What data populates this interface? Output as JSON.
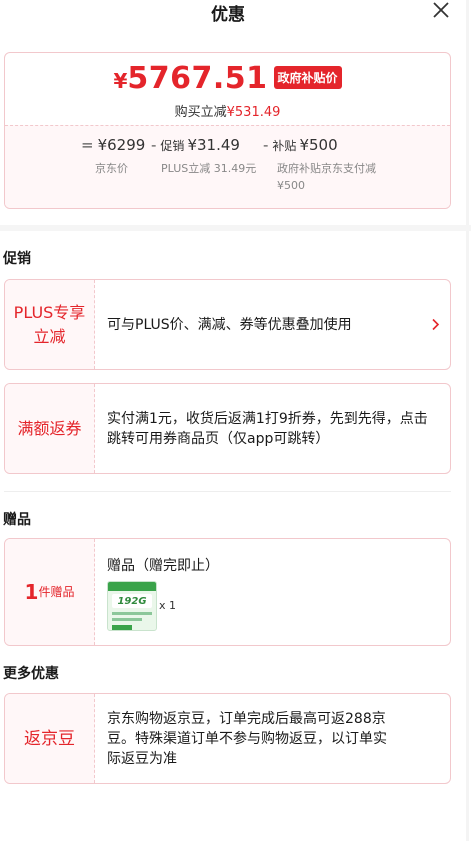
{
  "header": {
    "title": "优惠"
  },
  "price": {
    "currency": "¥",
    "amount": "5767.51",
    "badge": "政府补贴价",
    "sub_label": "购买立减",
    "sub_value": "¥531.49"
  },
  "breakdown": [
    {
      "op": "=",
      "prefix": "",
      "value": "¥6299",
      "label": "京东价"
    },
    {
      "op": "-",
      "prefix": "促销",
      "value": "¥31.49",
      "label": "PLUS立减 31.49元"
    },
    {
      "op": "-",
      "prefix": "补贴",
      "value": "¥500",
      "label": "政府补贴京东支付减¥500"
    }
  ],
  "sections": {
    "promotion": "促销",
    "gift": "赠品",
    "more": "更多优惠"
  },
  "promos": [
    {
      "tag": "PLUS专享立减",
      "desc": "可与PLUS价、满减、券等优惠叠加使用"
    },
    {
      "tag": "满额返券",
      "desc": "实付满1元，收货后返满1打9折券，先到先得，点击跳转可用券商品页（仅app可跳转）"
    }
  ],
  "gift": {
    "count": "1",
    "unit": "件赠品",
    "title": "赠品（赠完即止）",
    "image_text": "192G",
    "quantity": "x 1"
  },
  "more_promo": {
    "tag": "返京豆",
    "desc": "京东购物返京豆，订单完成后最高可返288京豆。特殊渠道订单不参与购物返豆，以订单实际返豆为准"
  },
  "colors": {
    "accent": "#e4252b",
    "border": "#f2c8cc",
    "panel": "#fff7f8"
  },
  "icons": {
    "close": "close-icon",
    "chevron": "chevron-right-icon"
  }
}
